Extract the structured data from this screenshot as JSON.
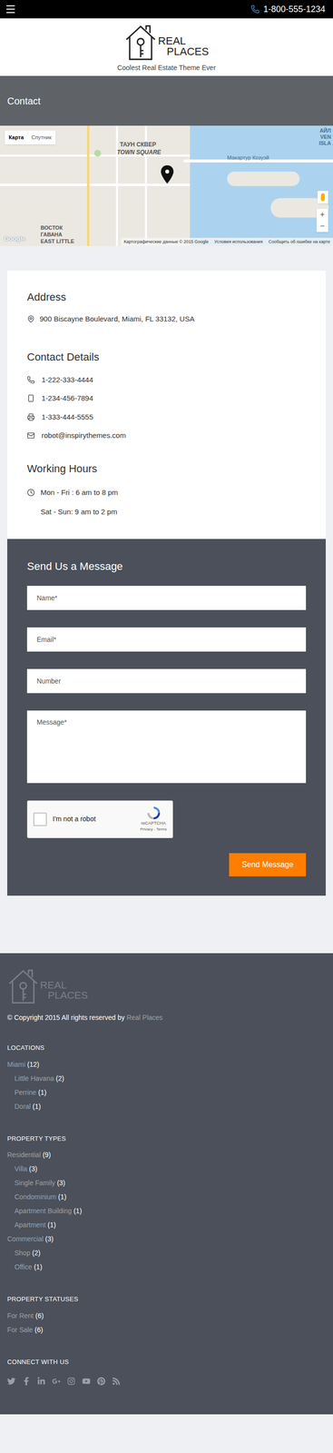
{
  "header": {
    "phone": "1-800-555-1234"
  },
  "logo": {
    "words": [
      "REAL",
      "PLACES"
    ],
    "tagline": "Coolest Real Estate Theme Ever"
  },
  "banner": {
    "title": "Contact"
  },
  "map": {
    "type_buttons": [
      {
        "label": "Карта",
        "selected": true
      },
      {
        "label": "Спутник",
        "selected": false
      }
    ],
    "labels": [
      "ТАУН СКВЕР",
      "TOWN SQUARE",
      "ВОСТОК",
      "ГАВАНА",
      "EAST LITTLE",
      "Макартур Козуэй",
      "АЙЛ",
      "VEN",
      "ISLA"
    ],
    "zoom": [
      "+",
      "−"
    ],
    "brand": "Google",
    "attribution": [
      "Картографические данные © 2015 Google",
      "Условия использования",
      "Сообщить об ошибке на карте"
    ]
  },
  "contact": {
    "address_title": "Address",
    "address": "900 Biscayne Boulevard, Miami, FL 33132, USA",
    "details_title": "Contact Details",
    "details": [
      {
        "kind": "phone",
        "text": "1-222-333-4444"
      },
      {
        "kind": "mobile",
        "text": "1-234-456-7894"
      },
      {
        "kind": "fax",
        "text": "1-333-444-5555"
      },
      {
        "kind": "email",
        "text": "robot@inspirythemes.com"
      }
    ],
    "hours_title": "Working Hours",
    "hours": [
      "Mon - Fri : 6 am to 8 pm",
      "Sat - Sun: 9 am to 2 pm"
    ]
  },
  "form": {
    "title": "Send Us a Message",
    "fields": [
      {
        "kind": "input",
        "placeholder": "Name*"
      },
      {
        "kind": "input",
        "placeholder": "Email*"
      },
      {
        "kind": "input",
        "placeholder": "Number"
      },
      {
        "kind": "textarea",
        "placeholder": "Message*"
      }
    ],
    "captcha": {
      "label": "I'm not a robot",
      "checked": false,
      "brand": "reCAPTCHA",
      "links": "Privacy - Terms"
    },
    "submit": "Send Message"
  },
  "footer": {
    "logo_words": [
      "REAL",
      "PLACES"
    ],
    "copyright": {
      "text": "© Copyright 2015 All rights reserved by",
      "link": "Real Places"
    },
    "sections": [
      {
        "title": "LOCATIONS",
        "items": [
          {
            "name": "Miami",
            "count": "(12)",
            "children": [
              {
                "name": "Little Havana",
                "count": "(2)"
              },
              {
                "name": "Perrine",
                "count": "(1)"
              },
              {
                "name": "Doral",
                "count": "(1)"
              }
            ]
          }
        ]
      },
      {
        "title": "PROPERTY TYPES",
        "items": [
          {
            "name": "Residential",
            "count": "(9)",
            "children": [
              {
                "name": "Villa",
                "count": "(3)"
              },
              {
                "name": "Single Family",
                "count": "(3)"
              },
              {
                "name": "Condominium",
                "count": "(1)"
              },
              {
                "name": "Apartment Building",
                "count": "(1)"
              },
              {
                "name": "Apartment",
                "count": "(1)"
              }
            ]
          },
          {
            "name": "Commercial",
            "count": "(3)",
            "children": [
              {
                "name": "Shop",
                "count": "(2)"
              },
              {
                "name": "Office",
                "count": "(1)"
              }
            ]
          }
        ]
      },
      {
        "title": "PROPERTY STATUSES",
        "items": [
          {
            "name": "For Rent",
            "count": "(6)",
            "children": []
          },
          {
            "name": "For Sale",
            "count": "(6)",
            "children": []
          }
        ]
      }
    ],
    "connect_title": "CONNECT WITH US"
  }
}
